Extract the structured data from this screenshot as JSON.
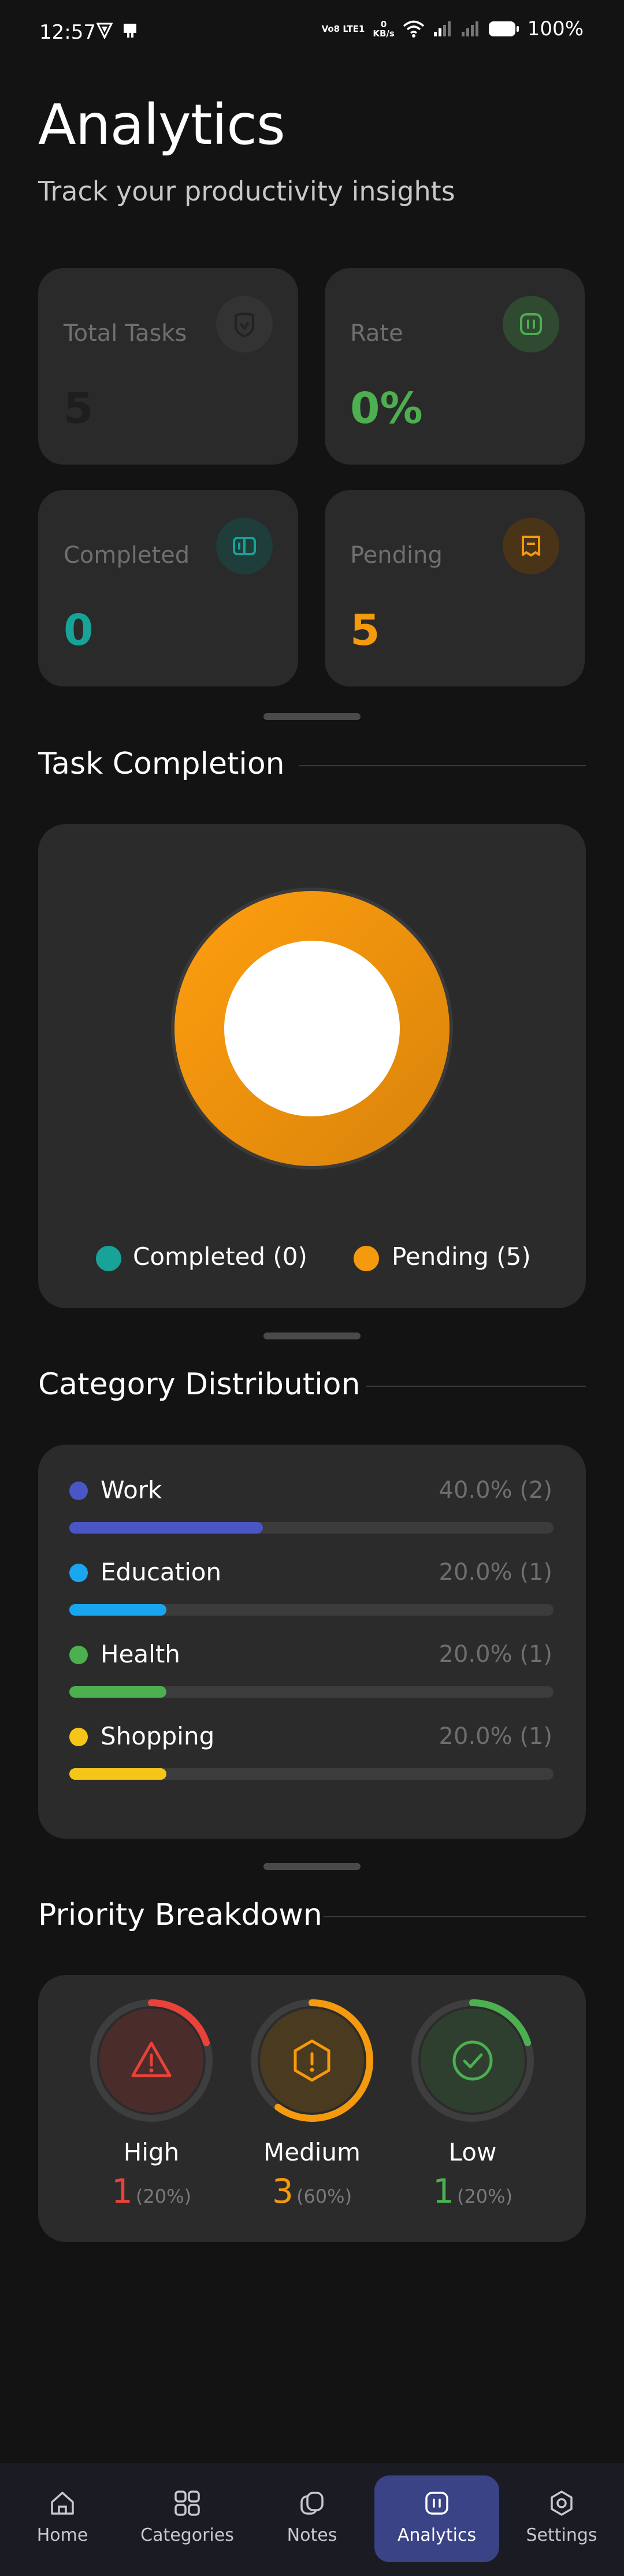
{
  "status_bar": {
    "time": "12:57",
    "net_top": "Vo8 LTE1",
    "net_speed": "0",
    "net_unit": "KB/s",
    "battery": "100%"
  },
  "header": {
    "title": "Analytics",
    "subtitle": "Track your productivity insights"
  },
  "stats": {
    "total_label": "Total Tasks",
    "total_value": "5",
    "rate_label": "Rate",
    "rate_value": "0%",
    "completed_label": "Completed",
    "completed_value": "0",
    "pending_label": "Pending",
    "pending_value": "5"
  },
  "task_completion": {
    "title": "Task Completion",
    "completed_legend": "Completed (0)",
    "pending_legend": "Pending (5)",
    "completed": 0,
    "pending": 5,
    "completed_color": "#17a398",
    "pending_color": "#f59a0c"
  },
  "category_distribution": {
    "title": "Category Distribution",
    "items": [
      {
        "name": "Work",
        "value": "40.0% (2)",
        "fraction": 0.4,
        "color": "#4b56c6"
      },
      {
        "name": "Education",
        "value": "20.0% (1)",
        "fraction": 0.2,
        "color": "#1aa6ee"
      },
      {
        "name": "Health",
        "value": "20.0% (1)",
        "fraction": 0.2,
        "color": "#4caf50"
      },
      {
        "name": "Shopping",
        "value": "20.0% (1)",
        "fraction": 0.2,
        "color": "#f5c518"
      }
    ]
  },
  "priority": {
    "title": "Priority Breakdown",
    "items": [
      {
        "label": "High",
        "count": "1",
        "pct": "(20%)",
        "fraction": 0.2,
        "color": "#e8423a",
        "icon": "warning-triangle-icon"
      },
      {
        "label": "Medium",
        "count": "3",
        "pct": "(60%)",
        "fraction": 0.6,
        "color": "#f59a0c",
        "icon": "alert-hexagon-icon"
      },
      {
        "label": "Low",
        "count": "1",
        "pct": "(20%)",
        "fraction": 0.2,
        "color": "#4caf50",
        "icon": "check-circle-icon"
      }
    ]
  },
  "nav": {
    "home": "Home",
    "categories": "Categories",
    "notes": "Notes",
    "analytics": "Analytics",
    "settings": "Settings",
    "active": "Analytics",
    "active_color": "#3a4385"
  }
}
